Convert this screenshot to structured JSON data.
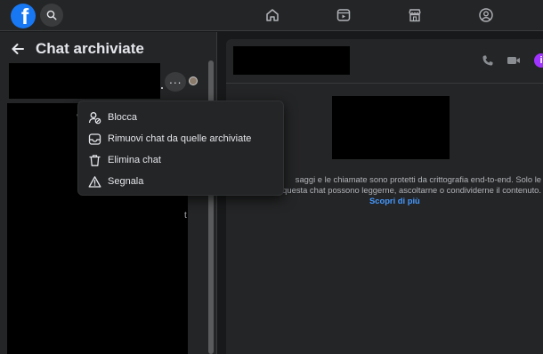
{
  "topbar": {
    "logo_letter": "f",
    "icons": [
      "facebook-logo",
      "search-icon",
      "home-icon",
      "video-icon",
      "marketplace-icon",
      "groups-icon"
    ]
  },
  "left_panel": {
    "title": "Chat archiviate",
    "more_label": "···",
    "peek_chars": [
      "v",
      "t"
    ]
  },
  "menu": {
    "items": [
      {
        "label": "Blocca",
        "icon": "block-user-icon"
      },
      {
        "label": "Rimuovi chat da quelle archiviate",
        "icon": "unarchive-icon"
      },
      {
        "label": "Elimina chat",
        "icon": "trash-icon"
      },
      {
        "label": "Segnala",
        "icon": "warning-icon"
      }
    ]
  },
  "chat_panel": {
    "encryption_line1": "saggi e le chiamate sono protetti da crittografia end-to-end. Solo le",
    "encryption_line2": "questa chat possono leggerne, ascoltarne o condividerne il contenuto.",
    "learn_more": "Scopri di più",
    "info_glyph": "i"
  },
  "colors": {
    "background": "#18191a",
    "panel": "#242526",
    "accent_blue": "#1877f2",
    "link": "#4599ff",
    "info_purple": "#a033ff"
  }
}
